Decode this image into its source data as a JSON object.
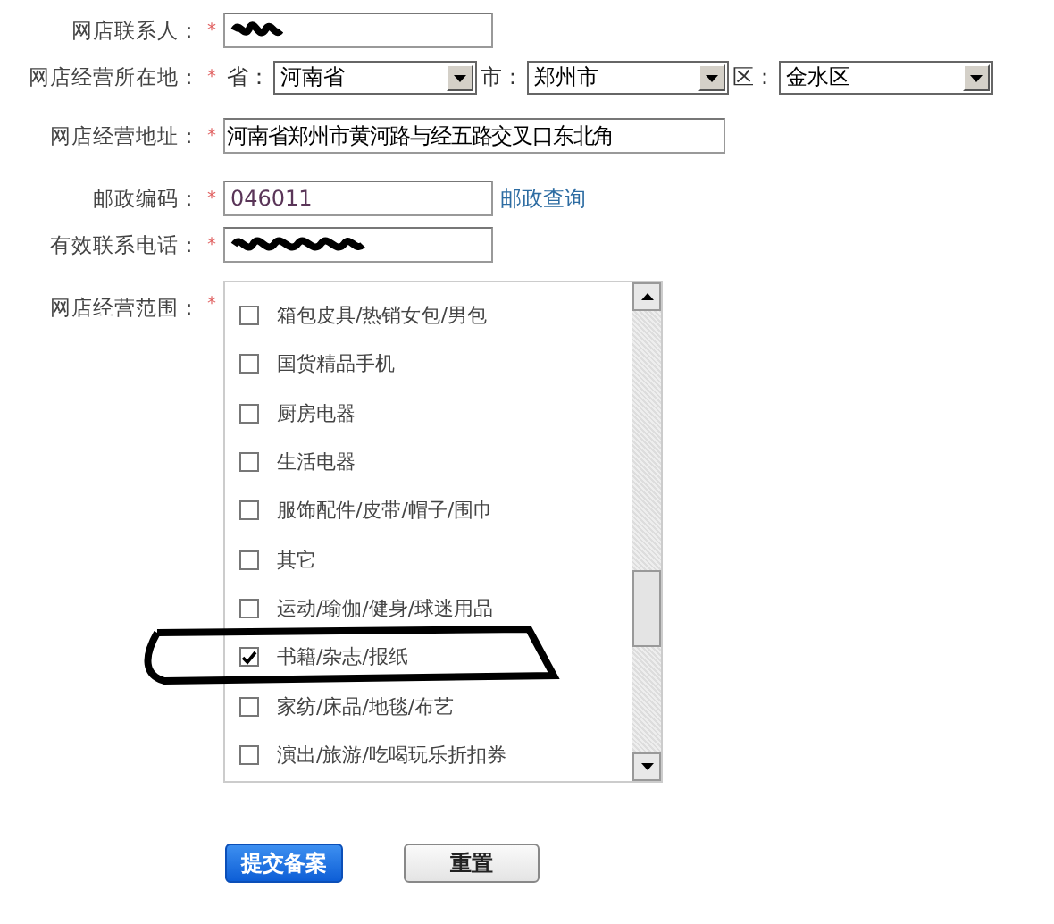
{
  "contact": {
    "label": "网店联系人：",
    "required_mark": "*",
    "redacted": true
  },
  "location": {
    "label": "网店经营所在地：",
    "required_mark": "*",
    "selects": [
      {
        "label": "省：",
        "value": "河南省"
      },
      {
        "label": "市：",
        "value": "郑州市"
      },
      {
        "label": "区：",
        "value": "金水区"
      }
    ]
  },
  "address": {
    "label": "网店经营地址：",
    "required_mark": "*",
    "value": "河南省郑州市黄河路与经五路交叉口东北角"
  },
  "postcode": {
    "label": "邮政编码：",
    "required_mark": "*",
    "value": "046011",
    "link": "邮政查询"
  },
  "phone": {
    "label": "有效联系电话：",
    "required_mark": "*",
    "redacted": true
  },
  "scope": {
    "label": "网店经营范围：",
    "required_mark": "*",
    "items": [
      {
        "label": "箱包皮具/热销女包/男包",
        "checked": false,
        "circled": false
      },
      {
        "label": "国货精品手机",
        "checked": false,
        "circled": false
      },
      {
        "label": "厨房电器",
        "checked": false,
        "circled": false
      },
      {
        "label": "生活电器",
        "checked": false,
        "circled": false
      },
      {
        "label": "服饰配件/皮带/帽子/围巾",
        "checked": false,
        "circled": false
      },
      {
        "label": "其它",
        "checked": false,
        "circled": false
      },
      {
        "label": "运动/瑜伽/健身/球迷用品",
        "checked": false,
        "circled": false
      },
      {
        "label": "书籍/杂志/报纸",
        "checked": true,
        "circled": true
      },
      {
        "label": "家纺/床品/地毯/布艺",
        "checked": false,
        "circled": false
      },
      {
        "label": "演出/旅游/吃喝玩乐折扣券",
        "checked": false,
        "circled": false
      }
    ]
  },
  "buttons": [
    {
      "label": "提交备案",
      "kind": "primary"
    },
    {
      "label": "重置",
      "kind": "secondary"
    }
  ]
}
